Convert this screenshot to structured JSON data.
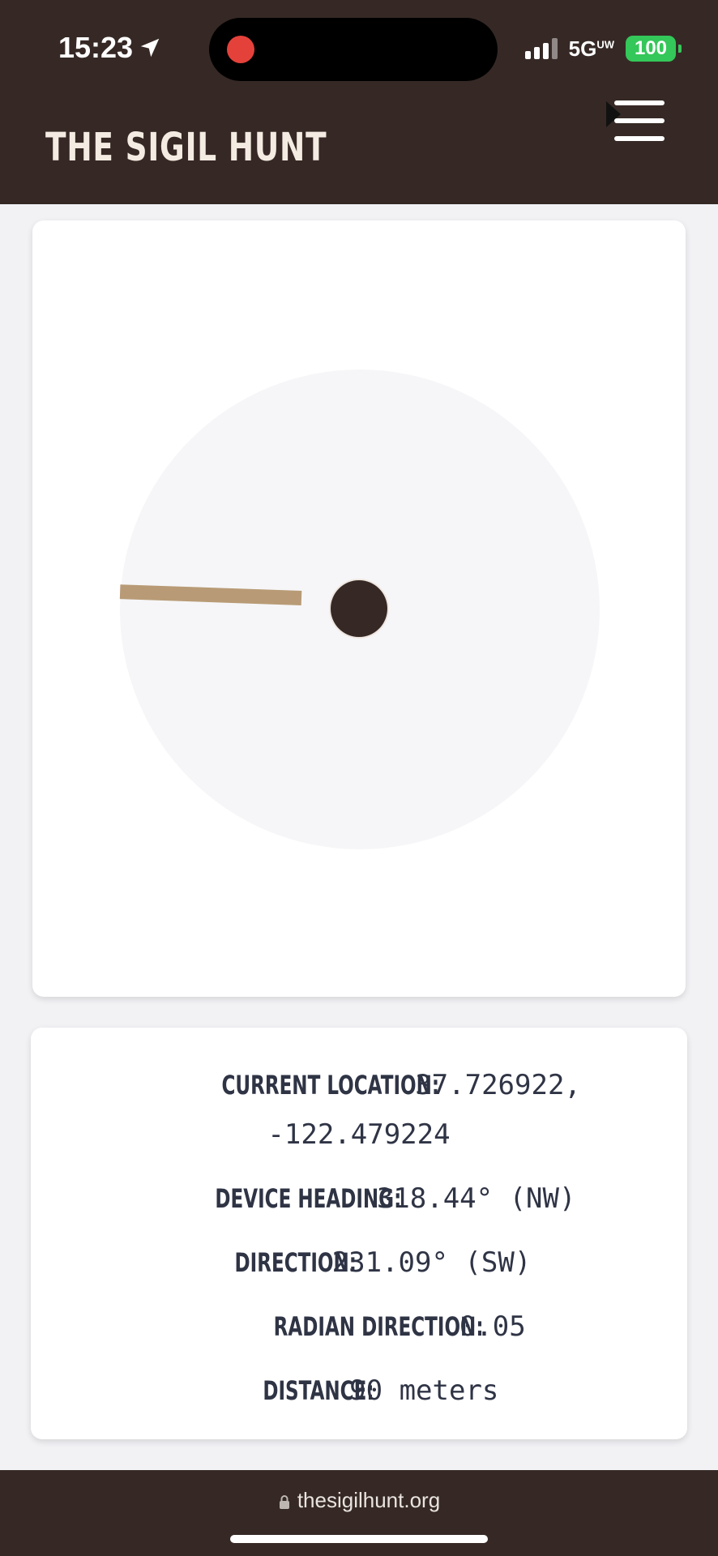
{
  "status_bar": {
    "time": "15:23",
    "network": "5G",
    "network_sup": "UW",
    "battery": "100"
  },
  "header": {
    "brand": "THE SIGIL HUNT"
  },
  "compass": {
    "heading_deg": 318.44,
    "direction_deg": 231.09
  },
  "info": {
    "current_location_label": "CURRENT LOCATION:",
    "current_location_lat": "37.726922,",
    "current_location_lon": "-122.479224",
    "device_heading_label": "DEVICE HEADING:",
    "device_heading_value": "318.44° (NW)",
    "direction_label": "DIRECTION:",
    "direction_value": "231.09° (SW)",
    "radian_direction_label": "RADIAN DIRECTION:",
    "radian_direction_value": "0.05",
    "distance_label": "DISTANCE:",
    "distance_value": "90 meters"
  },
  "browser": {
    "url": "thesigilhunt.org"
  },
  "colors": {
    "header_bg": "#362925",
    "needle": "#b89b76",
    "battery": "#34c759",
    "record_dot": "#e5413b"
  }
}
